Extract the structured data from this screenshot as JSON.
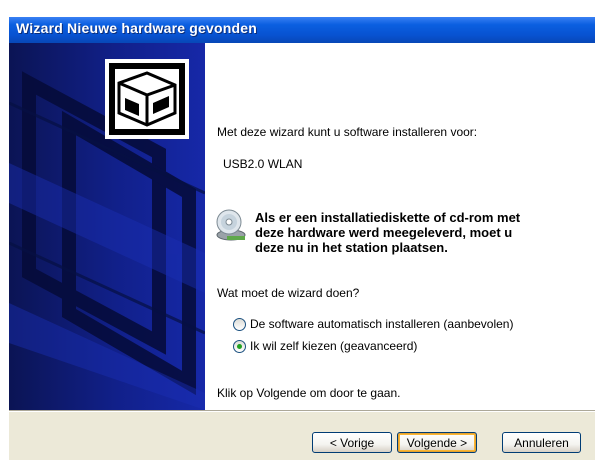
{
  "window": {
    "title": "Wizard Nieuwe hardware gevonden"
  },
  "intro": {
    "line": "Met deze wizard kunt u software installeren voor:",
    "device": "USB2.0 WLAN"
  },
  "notice": {
    "line1": "Als er een installatiediskette of cd-rom met",
    "line2": "deze hardware werd meegeleverd, moet u",
    "line3": "deze nu in het station plaatsen."
  },
  "question": "Wat moet de wizard doen?",
  "options": [
    {
      "label": "De software automatisch installeren (aanbevolen)",
      "selected": false
    },
    {
      "label": "Ik wil zelf kiezen (geavanceerd)",
      "selected": true
    }
  ],
  "footer_hint": "Klik op Volgende om door te gaan.",
  "buttons": {
    "back": "< Vorige",
    "next": "Volgende >",
    "cancel": "Annuleren"
  },
  "colors": {
    "titlebar": "#0852d1",
    "side_panel": "#11208a",
    "footer": "#ece9d8"
  }
}
